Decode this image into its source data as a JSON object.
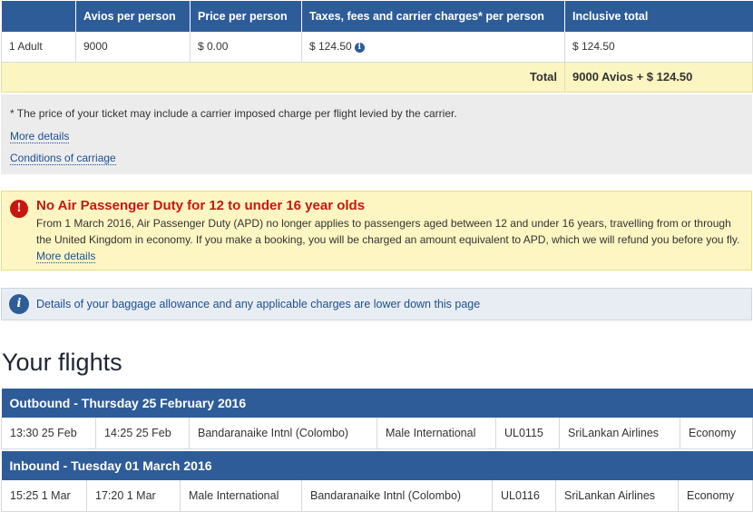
{
  "price_table": {
    "headers": [
      "",
      "Avios per person",
      "Price per person",
      "Taxes, fees and carrier charges* per person",
      "Inclusive total"
    ],
    "row": {
      "passenger": "1 Adult",
      "avios": "9000",
      "price": "$ 0.00",
      "taxes": "$ 124.50",
      "inclusive_total": "$ 124.50"
    },
    "total_label": "Total",
    "total_value": "9000 Avios + $ 124.50",
    "info_icon_glyph": "i"
  },
  "notes": {
    "carrier_note": "* The price of your ticket may include a carrier imposed charge per flight levied by the carrier.",
    "more_details": "More details",
    "conditions": "Conditions of carriage"
  },
  "apd_alert": {
    "icon_glyph": "!",
    "title": "No Air Passenger Duty for 12 to under 16 year olds",
    "body": "From 1 March 2016, Air Passenger Duty (APD) no longer applies to passengers aged between 12 and under 16 years, travelling from or through the United Kingdom in economy. If you make a booking, you will be charged an amount equivalent to APD, which we will refund you before you fly.",
    "link": "More details"
  },
  "baggage_info": {
    "icon_glyph": "i",
    "text": "Details of your baggage allowance and any applicable charges are lower down this page"
  },
  "flights": {
    "heading": "Your flights",
    "outbound": {
      "header": "Outbound - Thursday 25 February 2016",
      "cells": [
        "13:30 25 Feb",
        "14:25 25 Feb",
        "Bandaranaike Intnl (Colombo)",
        "Male International",
        "UL0115",
        "SriLankan Airlines",
        "Economy"
      ]
    },
    "inbound": {
      "header": "Inbound - Tuesday 01 March 2016",
      "cells": [
        "15:25 1 Mar",
        "17:20 1 Mar",
        "Male International",
        "Bandaranaike Intnl (Colombo)",
        "UL0116",
        "SriLankan Airlines",
        "Economy"
      ]
    }
  },
  "colors": {
    "header_blue": "#2e5c99",
    "alert_red": "#c8170e",
    "link_blue": "#1d4f91",
    "total_bg": "#fbf5c2"
  }
}
